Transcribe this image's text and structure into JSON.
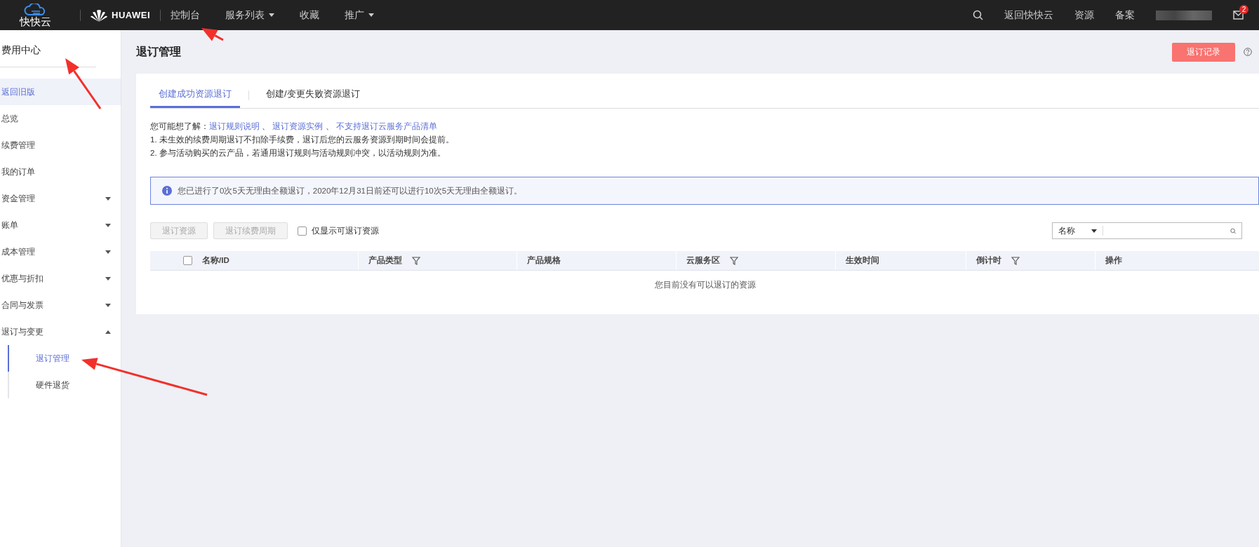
{
  "topbar": {
    "logo_text": "快快云",
    "brand": "HUAWEI",
    "nav": [
      {
        "label": "控制台",
        "dropdown": false
      },
      {
        "label": "服务列表",
        "dropdown": true
      },
      {
        "label": "收藏",
        "dropdown": false
      },
      {
        "label": "推广",
        "dropdown": true
      }
    ],
    "links": [
      "返回快快云",
      "资源",
      "备案"
    ],
    "mail_badge": "2"
  },
  "sidebar": {
    "title": "费用中心",
    "items": [
      {
        "label": "返回旧版",
        "selected": true,
        "kind": "link"
      },
      {
        "label": "总览",
        "selected": false,
        "kind": "link"
      },
      {
        "label": "续费管理",
        "selected": false,
        "kind": "link"
      },
      {
        "label": "我的订单",
        "selected": false,
        "kind": "link"
      },
      {
        "label": "资金管理",
        "selected": false,
        "kind": "group",
        "expanded": false
      },
      {
        "label": "账单",
        "selected": false,
        "kind": "group",
        "expanded": false
      },
      {
        "label": "成本管理",
        "selected": false,
        "kind": "group",
        "expanded": false
      },
      {
        "label": "优惠与折扣",
        "selected": false,
        "kind": "group",
        "expanded": false
      },
      {
        "label": "合同与发票",
        "selected": false,
        "kind": "group",
        "expanded": false
      },
      {
        "label": "退订与变更",
        "selected": false,
        "kind": "group",
        "expanded": true,
        "children": [
          {
            "label": "退订管理",
            "selected": true
          },
          {
            "label": "硬件退货",
            "selected": false
          }
        ]
      }
    ]
  },
  "page": {
    "title": "退订管理",
    "record_button": "退订记录",
    "tabs": [
      {
        "label": "创建成功资源退订",
        "selected": true
      },
      {
        "label": "创建/变更失败资源退订",
        "selected": false
      }
    ],
    "hint_lead": "您可能想了解：",
    "hint_links": [
      "退订规则说明",
      "退订资源实例",
      "不支持退订云服务产品清单"
    ],
    "hint_separator": "、",
    "notes": [
      "1. 未生效的续费周期退订不扣除手续费，退订后您的云服务资源到期时间会提前。",
      "2. 参与活动购买的云产品，若通用退订规则与活动规则冲突，以活动规则为准。"
    ],
    "notice": "您已进行了0次5天无理由全额退订，2020年12月31日前还可以进行10次5天无理由全额退订。",
    "actions": [
      {
        "label": "退订资源",
        "disabled": true
      },
      {
        "label": "退订续费周期",
        "disabled": true
      }
    ],
    "filter_checkbox": {
      "label": "仅显示可退订资源",
      "checked": false
    },
    "search": {
      "field": "名称"
    },
    "table": {
      "select_all_checked": false,
      "columns": [
        {
          "label": "名称/ID",
          "filter": false
        },
        {
          "label": "产品类型",
          "filter": true
        },
        {
          "label": "产品规格",
          "filter": false
        },
        {
          "label": "云服务区",
          "filter": true
        },
        {
          "label": "生效时间",
          "filter": false
        },
        {
          "label": "倒计时",
          "filter": true
        },
        {
          "label": "操作",
          "filter": false
        }
      ],
      "empty_text": "您目前没有可以退订的资源"
    }
  }
}
